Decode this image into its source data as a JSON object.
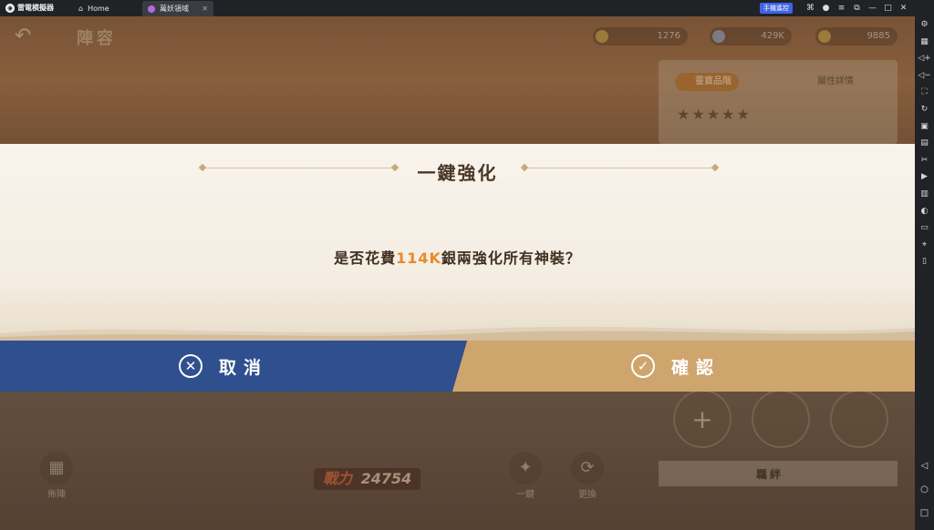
{
  "emulator": {
    "brand": "雷電模擬器",
    "tabs": [
      {
        "label": "Home",
        "icon": "home-icon"
      },
      {
        "label": "萬妖領域",
        "icon": "game-icon"
      }
    ],
    "remote_label": "手機遙控",
    "window_controls": [
      "gamepad-icon",
      "user-icon",
      "menu-icon",
      "restore-icon",
      "minimize-icon",
      "maximize-icon",
      "close-icon"
    ],
    "sidebar_icons": [
      "settings-icon",
      "keyboard-icon",
      "volume-up-icon",
      "volume-down-icon",
      "screenshot-icon",
      "rotate-icon",
      "record-icon",
      "apk-icon",
      "scissors-icon",
      "video-icon",
      "sync-icon",
      "shake-icon",
      "folder-icon",
      "location-icon",
      "vibrate-icon"
    ],
    "nav_icons": [
      "back-nav-icon",
      "home-nav-icon",
      "recent-nav-icon"
    ]
  },
  "game": {
    "back_label": "↶",
    "page_title": "陣容",
    "resources": [
      {
        "icon": "gem-icon",
        "value": "1276"
      },
      {
        "icon": "silver-icon",
        "value": "429K"
      },
      {
        "icon": "gold-icon",
        "value": "9885"
      }
    ],
    "panel_tag_1": "靈寶品階",
    "panel_tag_2": "屬性詳情",
    "stars": "★★★★★",
    "slot_plus": "+",
    "slot_label": "羈絆",
    "power_label": "戰力",
    "power_value": "24754",
    "footer_left": "佈陣",
    "footer_mid": "一鍵",
    "footer_right": "更換"
  },
  "dialog": {
    "title": "一鍵強化",
    "message_prefix": "是否花費",
    "message_amount": "114K",
    "message_suffix": "銀兩強化所有神裝？",
    "cancel_label": "取消",
    "confirm_label": "確認",
    "cancel_icon": "✕",
    "confirm_icon": "✓"
  },
  "colors": {
    "cancel_bg": "#2f4f8e",
    "confirm_bg": "#cfa56e",
    "highlight": "#e88a2c"
  }
}
